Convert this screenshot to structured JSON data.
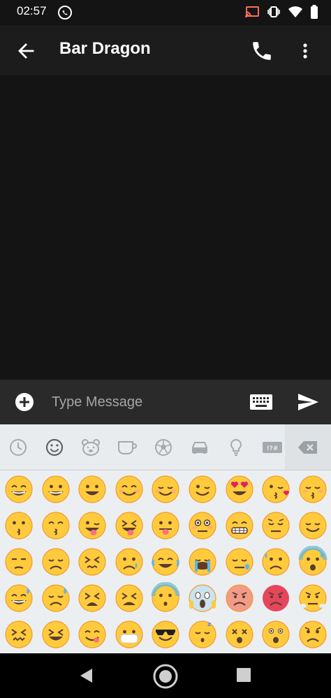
{
  "status_bar": {
    "time": "02:57",
    "left_icon": "whatsapp-icon",
    "right_icons": [
      "cast-icon",
      "vibrate-icon",
      "wifi-icon",
      "battery-icon"
    ]
  },
  "app_bar": {
    "title": "Bar Dragon",
    "back_icon": "arrow-back-icon",
    "call_icon": "phone-icon",
    "more_icon": "more-vert-icon"
  },
  "composer": {
    "placeholder": "Type Message",
    "value": "",
    "add_icon": "add-circle-icon",
    "keyboard_icon": "keyboard-icon",
    "send_icon": "send-icon"
  },
  "emoji_keyboard": {
    "tabs": [
      {
        "name": "recent",
        "icon": "clock-icon"
      },
      {
        "name": "smileys",
        "icon": "smiley-icon",
        "selected": true
      },
      {
        "name": "animals",
        "icon": "bear-icon"
      },
      {
        "name": "food",
        "icon": "cup-icon"
      },
      {
        "name": "activities",
        "icon": "soccer-ball-icon"
      },
      {
        "name": "travel",
        "icon": "car-icon"
      },
      {
        "name": "objects",
        "icon": "lightbulb-icon"
      },
      {
        "name": "symbols",
        "icon": "symbols-icon",
        "label": "!?#"
      },
      {
        "name": "delete",
        "icon": "backspace-icon"
      }
    ],
    "emojis": [
      [
        "😄",
        "😀",
        "😃",
        "😊",
        "☺️",
        "😉",
        "😍",
        "😘",
        "😚"
      ],
      [
        "😗",
        "😙",
        "😜",
        "😝",
        "😛",
        "😳",
        "😁",
        "😔",
        "😌"
      ],
      [
        "😒",
        "😞",
        "😣",
        "😢",
        "😂",
        "😭",
        "😪",
        "😥",
        "😰"
      ],
      [
        "😅",
        "😓",
        "😩",
        "😫",
        "😨",
        "😱",
        "😠",
        "😡",
        "😤"
      ],
      [
        "😖",
        "😆",
        "😋",
        "😷",
        "😎",
        "😴",
        "😵",
        "😲",
        "😟"
      ],
      [
        "😦",
        "😧",
        "😈",
        "👿",
        "😮",
        "😬",
        "😐",
        "😕",
        "😯"
      ]
    ]
  },
  "nav_bar": {
    "back_icon": "nav-back-icon",
    "home_icon": "nav-home-icon",
    "recents_icon": "nav-recents-icon"
  }
}
